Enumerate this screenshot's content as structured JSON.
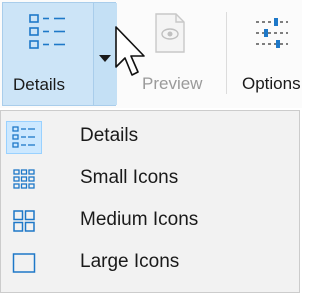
{
  "ribbon": {
    "details_label": "Details",
    "preview_label": "Preview",
    "options_label": "Options"
  },
  "layout_menu": {
    "items": [
      {
        "label": "Details",
        "icon": "details-view-icon",
        "selected": true
      },
      {
        "label": "Small Icons",
        "icon": "small-icons-icon",
        "selected": false
      },
      {
        "label": "Medium Icons",
        "icon": "medium-icons-icon",
        "selected": false
      },
      {
        "label": "Large Icons",
        "icon": "large-icons-icon",
        "selected": false
      }
    ]
  },
  "colors": {
    "accent": "#1e78c8",
    "selection_bg": "#cce8ff",
    "ribbon_hover": "#cce4f7"
  }
}
